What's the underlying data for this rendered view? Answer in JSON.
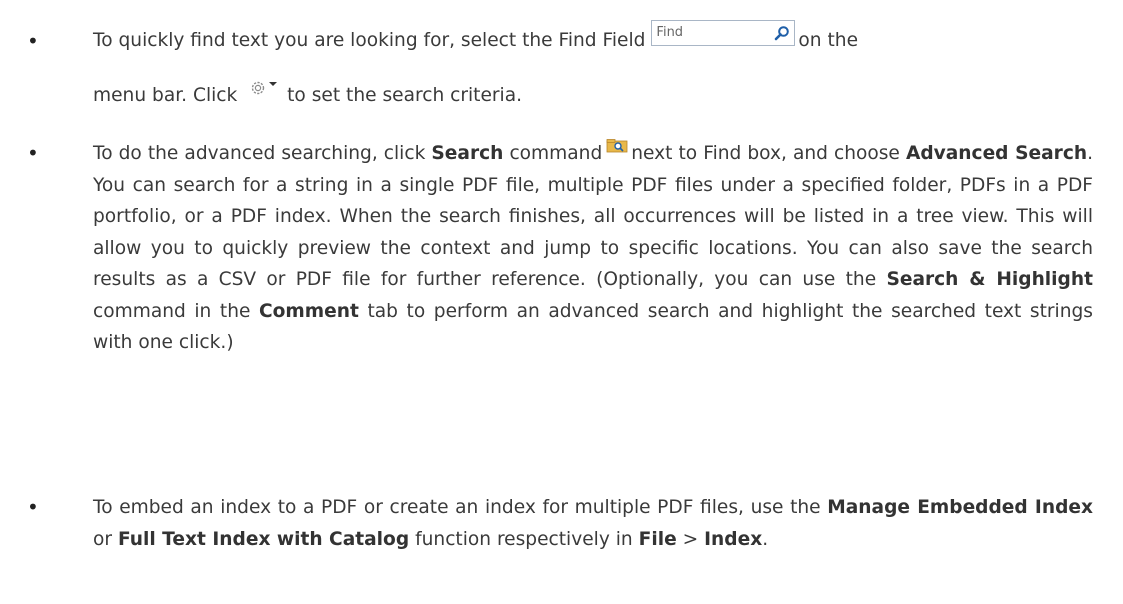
{
  "bullets": {
    "symbol": "•",
    "item1": {
      "t1": "To quickly find text you are looking for, select the Find Field",
      "find_placeholder": "Find",
      "t2": "on the",
      "t3": "menu bar. Click",
      "t4": "to set the search criteria."
    },
    "item2": {
      "t1": "To do the advanced searching, click",
      "b1": "Search",
      "t2": "command",
      "t3": "next to Find box, and choose",
      "b2": "Advanced Search",
      "t4": ". You can search for a string in a single PDF file, multiple PDF files under a specified folder, PDFs in a PDF portfolio, or a PDF index. When the search finishes, all occurrences will be listed in a tree view. This will allow you to quickly preview the context and jump to specific locations. You can also save the search results as a CSV or PDF file for further reference. (Optionally, you can use the",
      "b3": "Search & Highlight",
      "t5": "command in the",
      "b4": "Comment",
      "t6": "tab to perform an advanced search and highlight the searched text strings with one click.)"
    },
    "item3": {
      "t1": "To embed an index to a PDF or create an index for multiple PDF files, use the",
      "b1": "Manage Embedded Index",
      "t2": "or",
      "b2": "Full Text Index with Catalog",
      "t3": "function respectively in",
      "b3": "File",
      "t4": ">",
      "b4": "Index",
      "t5": "."
    }
  },
  "icons": {
    "find_field": "magnifier-icon",
    "search_options": "gear-dropdown-icon",
    "search_command": "folder-search-icon"
  },
  "colors": {
    "text": "#3a3a3a",
    "find_border": "#a9b6c6",
    "magnifier": "#1f5fa8",
    "folder": "#e8b84a"
  }
}
